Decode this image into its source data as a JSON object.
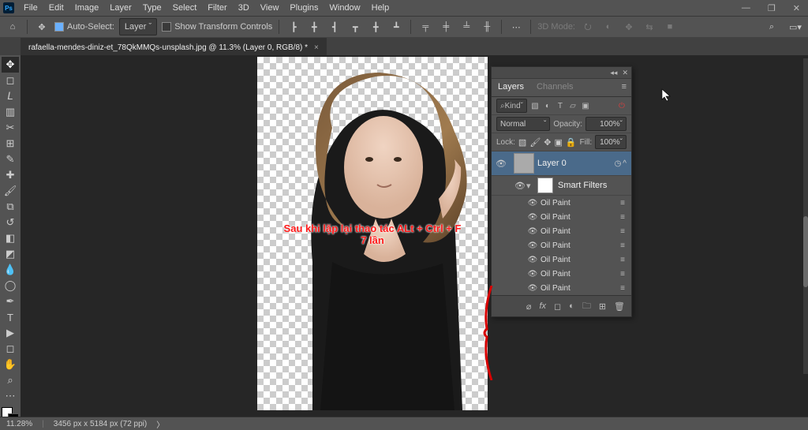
{
  "menu": {
    "items": [
      "File",
      "Edit",
      "Image",
      "Layer",
      "Type",
      "Select",
      "Filter",
      "3D",
      "View",
      "Plugins",
      "Window",
      "Help"
    ]
  },
  "optionsbar": {
    "auto_select_label": "Auto-Select:",
    "auto_select_target": "Layer",
    "show_transform_label": "Show Transform Controls",
    "mode3d_label": "3D Mode:"
  },
  "document": {
    "tab_title": "rafaella-mendes-diniz-et_78QkMMQs-unsplash.jpg @ 11.3% (Layer 0, RGB/8) *",
    "overlay_line1": "Sau khi lặp lại thao tác ALt + Ctrl + F",
    "overlay_line2": "7 lần"
  },
  "panel": {
    "tabs": [
      "Layers",
      "Channels"
    ],
    "filter_label": "Kind",
    "blend_mode": "Normal",
    "opacity_label": "Opacity:",
    "opacity_value": "100%",
    "lock_label": "Lock:",
    "fill_label": "Fill:",
    "fill_value": "100%",
    "layer0": "Layer 0",
    "smart_filters": "Smart Filters",
    "fx_name": "Oil Paint",
    "fx_count": 7
  },
  "status": {
    "zoom": "11.28%",
    "docinfo": "3456 px x 5184 px (72 ppi)"
  }
}
